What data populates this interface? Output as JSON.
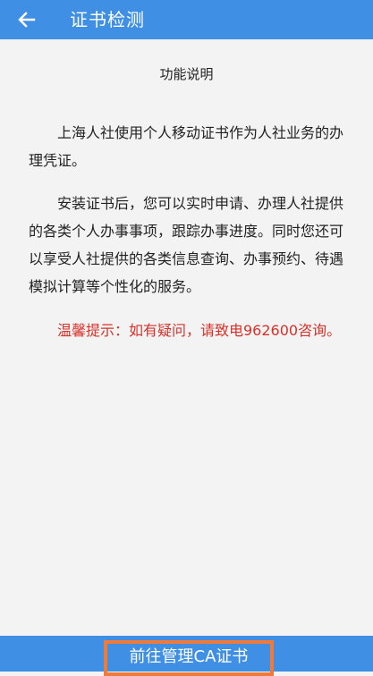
{
  "header": {
    "back_icon": "arrow-left-icon",
    "title": "证书检测"
  },
  "content": {
    "section_title": "功能说明",
    "paragraphs": [
      "上海人社使用个人移动证书作为人社业务的办理凭证。",
      "安装证书后，您可以实时申请、办理人社提供的各类个人办事事项，跟踪办事进度。同时您还可以享受人社提供的各类信息查询、办事预约、待遇模拟计算等个性化的服务。"
    ],
    "notice": "温馨提示：如有疑问，请致电962600咨询。"
  },
  "footer": {
    "button_label": "前往管理CA证书"
  },
  "colors": {
    "primary": "#3f8fe5",
    "notice": "#d6312a",
    "highlight_border": "#f07a3a",
    "background": "#f3f3f3"
  }
}
